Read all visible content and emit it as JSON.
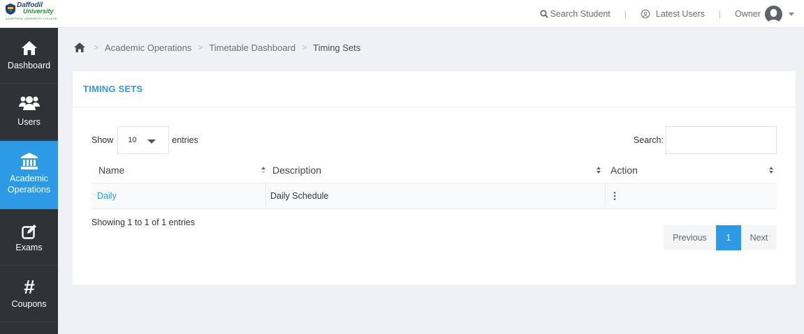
{
  "brand": {
    "name": "Daffodil",
    "sub": "University",
    "tagline": "A DAFFODIL UNIVERSITY COLLEGE"
  },
  "topbar": {
    "search_label": "Search Student",
    "separator": "|",
    "latest_users_label": "Latest Users",
    "owner_label": "Owner"
  },
  "sidebar": {
    "items": [
      {
        "label": "Dashboard",
        "icon": "home-icon",
        "active": false
      },
      {
        "label": "Users",
        "icon": "users-icon",
        "active": false
      },
      {
        "label": "Academic",
        "label2": "Operations",
        "icon": "bank-icon",
        "active": true
      },
      {
        "label": "Exams",
        "icon": "edit-icon",
        "active": false
      },
      {
        "label": "Coupons",
        "icon": "hash-icon",
        "active": false
      }
    ]
  },
  "breadcrumb": {
    "items": [
      "Academic Operations",
      "Timetable Dashboard",
      "Timing Sets"
    ],
    "separator": ">"
  },
  "panel": {
    "title": "TIMING SETS"
  },
  "table_controls": {
    "show_label": "Show",
    "page_size": "10",
    "entries_label": "entries",
    "search_label": "Search:",
    "search_value": ""
  },
  "table": {
    "columns": [
      "Name",
      "Description",
      "Action"
    ],
    "rows": [
      {
        "name": "Daily",
        "description": "Daily Schedule"
      }
    ]
  },
  "footer": {
    "info": "Showing 1 to 1 of 1 entries",
    "previous_label": "Previous",
    "current_page": "1",
    "next_label": "Next"
  },
  "colors": {
    "accent": "#2d9ae6",
    "sidebar_bg": "#2f3338",
    "page_bg": "#f0f1f4"
  }
}
